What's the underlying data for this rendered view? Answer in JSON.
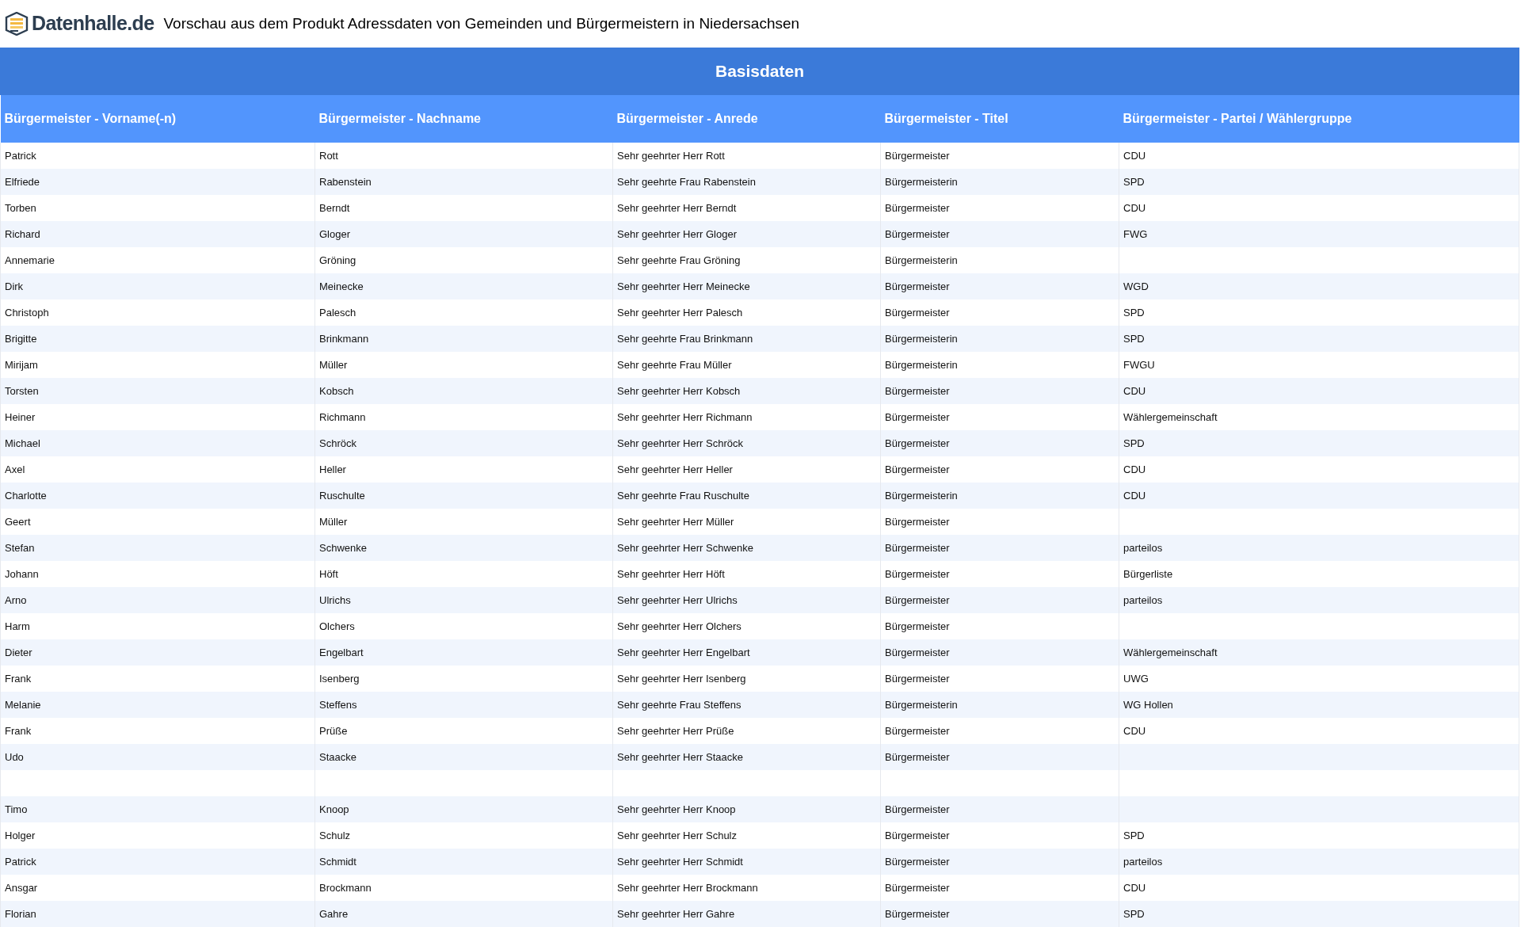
{
  "header": {
    "logo_text": "Datenhalle.de",
    "title": "Vorschau aus dem Produkt Adressdaten von Gemeinden und Bürgermeistern in Niedersachsen"
  },
  "table": {
    "group_heading": "Basisdaten",
    "columns": [
      "Bürgermeister - Vorname(-n)",
      "Bürgermeister - Nachname",
      "Bürgermeister - Anrede",
      "Bürgermeister - Titel",
      "Bürgermeister - Partei / Wählergruppe"
    ],
    "rows": [
      [
        "Patrick",
        "Rott",
        "Sehr geehrter Herr Rott",
        "Bürgermeister",
        "CDU"
      ],
      [
        "Elfriede",
        "Rabenstein",
        "Sehr geehrte Frau Rabenstein",
        "Bürgermeisterin",
        "SPD"
      ],
      [
        "Torben",
        "Berndt",
        "Sehr geehrter Herr Berndt",
        "Bürgermeister",
        "CDU"
      ],
      [
        "Richard",
        "Gloger",
        "Sehr geehrter Herr Gloger",
        "Bürgermeister",
        "FWG"
      ],
      [
        "Annemarie",
        "Gröning",
        "Sehr geehrte Frau Gröning",
        "Bürgermeisterin",
        null
      ],
      [
        "Dirk",
        "Meinecke",
        "Sehr geehrter Herr Meinecke",
        "Bürgermeister",
        "WGD"
      ],
      [
        "Christoph",
        "Palesch",
        "Sehr geehrter Herr Palesch",
        "Bürgermeister",
        "SPD"
      ],
      [
        "Brigitte",
        "Brinkmann",
        "Sehr geehrte Frau Brinkmann",
        "Bürgermeisterin",
        "SPD"
      ],
      [
        "Mirijam",
        "Müller",
        "Sehr geehrte Frau Müller",
        "Bürgermeisterin",
        "FWGU"
      ],
      [
        "Torsten",
        "Kobsch",
        "Sehr geehrter Herr Kobsch",
        "Bürgermeister",
        "CDU"
      ],
      [
        "Heiner",
        "Richmann",
        "Sehr geehrter Herr Richmann",
        "Bürgermeister",
        "Wählergemeinschaft"
      ],
      [
        "Michael",
        "Schröck",
        "Sehr geehrter Herr Schröck",
        "Bürgermeister",
        "SPD"
      ],
      [
        "Axel",
        "Heller",
        "Sehr geehrter Herr Heller",
        "Bürgermeister",
        "CDU"
      ],
      [
        "Charlotte",
        "Ruschulte",
        "Sehr geehrte Frau Ruschulte",
        "Bürgermeisterin",
        "CDU"
      ],
      [
        "Geert",
        "Müller",
        "Sehr geehrter Herr Müller",
        "Bürgermeister",
        null
      ],
      [
        "Stefan",
        "Schwenke",
        "Sehr geehrter Herr Schwenke",
        "Bürgermeister",
        "parteilos"
      ],
      [
        "Johann",
        "Höft",
        "Sehr geehrter Herr Höft",
        "Bürgermeister",
        "Bürgerliste"
      ],
      [
        "Arno",
        "Ulrichs",
        "Sehr geehrter Herr Ulrichs",
        "Bürgermeister",
        "parteilos"
      ],
      [
        "Harm",
        "Olchers",
        "Sehr geehrter Herr Olchers",
        "Bürgermeister",
        null
      ],
      [
        "Dieter",
        "Engelbart",
        "Sehr geehrter Herr Engelbart",
        "Bürgermeister",
        "Wählergemeinschaft"
      ],
      [
        "Frank",
        "Isenberg",
        "Sehr geehrter Herr Isenberg",
        "Bürgermeister",
        "UWG"
      ],
      [
        "Melanie",
        "Steffens",
        "Sehr geehrte Frau Steffens",
        "Bürgermeisterin",
        "WG Hollen"
      ],
      [
        "Frank",
        "Prüße",
        "Sehr geehrter Herr Prüße",
        "Bürgermeister",
        "CDU"
      ],
      [
        "Udo",
        "Staacke",
        "Sehr geehrter Herr Staacke",
        "Bürgermeister",
        null
      ],
      [
        null,
        null,
        null,
        null,
        null
      ],
      [
        "Timo",
        "Knoop",
        "Sehr geehrter Herr Knoop",
        "Bürgermeister",
        null
      ],
      [
        "Holger",
        "Schulz",
        "Sehr geehrter Herr Schulz",
        "Bürgermeister",
        "SPD"
      ],
      [
        "Patrick",
        "Schmidt",
        "Sehr geehrter Herr Schmidt",
        "Bürgermeister",
        "parteilos"
      ],
      [
        "Ansgar",
        "Brockmann",
        "Sehr geehrter Herr Brockmann",
        "Bürgermeister",
        "CDU"
      ],
      [
        "Florian",
        "Gahre",
        "Sehr geehrter Herr Gahre",
        "Bürgermeister",
        "SPD"
      ]
    ]
  }
}
